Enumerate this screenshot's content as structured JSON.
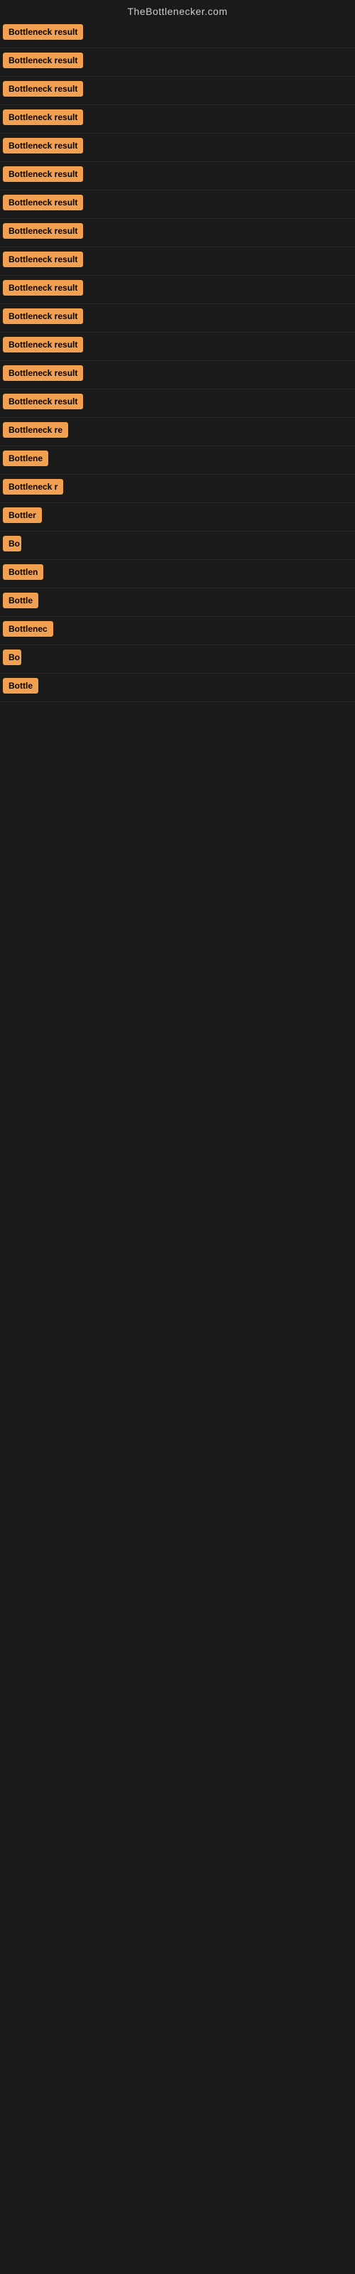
{
  "site": {
    "title": "TheBottlenecker.com"
  },
  "results": [
    {
      "label": "Bottleneck result",
      "width": 120
    },
    {
      "label": "Bottleneck result",
      "width": 120
    },
    {
      "label": "Bottleneck result",
      "width": 120
    },
    {
      "label": "Bottleneck result",
      "width": 120
    },
    {
      "label": "Bottleneck result",
      "width": 120
    },
    {
      "label": "Bottleneck result",
      "width": 120
    },
    {
      "label": "Bottleneck result",
      "width": 120
    },
    {
      "label": "Bottleneck result",
      "width": 120
    },
    {
      "label": "Bottleneck result",
      "width": 120
    },
    {
      "label": "Bottleneck result",
      "width": 120
    },
    {
      "label": "Bottleneck result",
      "width": 120
    },
    {
      "label": "Bottleneck result",
      "width": 120
    },
    {
      "label": "Bottleneck result",
      "width": 120
    },
    {
      "label": "Bottleneck result",
      "width": 120
    },
    {
      "label": "Bottleneck re",
      "width": 100
    },
    {
      "label": "Bottlene",
      "width": 78
    },
    {
      "label": "Bottleneck r",
      "width": 88
    },
    {
      "label": "Bottler",
      "width": 60
    },
    {
      "label": "Bo",
      "width": 26
    },
    {
      "label": "Bottlen",
      "width": 65
    },
    {
      "label": "Bottle",
      "width": 52
    },
    {
      "label": "Bottlenec",
      "width": 80
    },
    {
      "label": "Bo",
      "width": 26
    },
    {
      "label": "Bottle",
      "width": 52
    }
  ],
  "colors": {
    "badge_bg": "#f0a050",
    "badge_text": "#000000",
    "background": "#1a1a1a",
    "title_text": "#cccccc"
  }
}
